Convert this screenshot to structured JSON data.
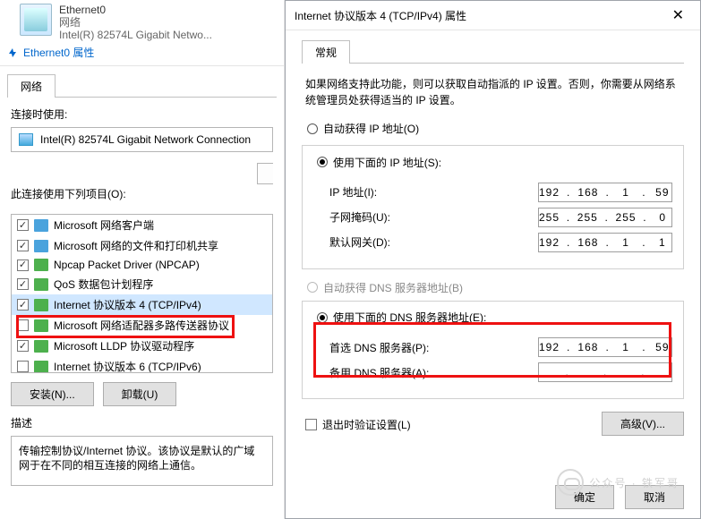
{
  "header": {
    "adapter_name": "Ethernet0",
    "adapter_sub": "网络",
    "adapter_model": "Intel(R) 82574L Gigabit Netwo..."
  },
  "breadcrumb": {
    "text": "Ethernet0 属性"
  },
  "left": {
    "tab_network": "网络",
    "connect_using": "连接时使用:",
    "adapter_full": "Intel(R) 82574L Gigabit Network Connection",
    "items_label": "此连接使用下列项目(O):",
    "items": [
      {
        "checked": true,
        "label": "Microsoft 网络客户端"
      },
      {
        "checked": true,
        "label": "Microsoft 网络的文件和打印机共享"
      },
      {
        "checked": true,
        "label": "Npcap Packet Driver (NPCAP)"
      },
      {
        "checked": true,
        "label": "QoS 数据包计划程序"
      },
      {
        "checked": true,
        "label": "Internet 协议版本 4 (TCP/IPv4)"
      },
      {
        "checked": false,
        "label": "Microsoft 网络适配器多路传送器协议"
      },
      {
        "checked": true,
        "label": "Microsoft LLDP 协议驱动程序"
      },
      {
        "checked": false,
        "label": "Internet 协议版本 6 (TCP/IPv6)"
      }
    ],
    "btn_install": "安装(N)...",
    "btn_uninstall": "卸载(U)",
    "desc_title": "描述",
    "desc_text": "传输控制协议/Internet 协议。该协议是默认的广域网于在不同的相互连接的网络上通信。"
  },
  "dlg": {
    "title": "Internet 协议版本 4 (TCP/IPv4) 属性",
    "tab_general": "常规",
    "info": "如果网络支持此功能，则可以获取自动指派的 IP 设置。否则，你需要从网络系统管理员处获得适当的 IP 设置。",
    "radio_auto_ip": "自动获得 IP 地址(O)",
    "radio_use_ip": "使用下面的 IP 地址(S):",
    "lbl_ip": "IP 地址(I):",
    "lbl_mask": "子网掩码(U):",
    "lbl_gw": "默认网关(D):",
    "ip": [
      "192",
      "168",
      "1",
      "59"
    ],
    "mask": [
      "255",
      "255",
      "255",
      "0"
    ],
    "gw": [
      "192",
      "168",
      "1",
      "1"
    ],
    "radio_auto_dns": "自动获得 DNS 服务器地址(B)",
    "radio_use_dns": "使用下面的 DNS 服务器地址(E):",
    "lbl_dns1": "首选 DNS 服务器(P):",
    "lbl_dns2": "备用 DNS 服务器(A):",
    "dns1": [
      "192",
      "168",
      "1",
      "59"
    ],
    "dns2": [
      "",
      "",
      "",
      ""
    ],
    "chk_validate": "退出时验证设置(L)",
    "btn_adv": "高级(V)...",
    "btn_ok": "确定",
    "btn_cancel": "取消"
  },
  "watermark": "公众号 · 铁军哥"
}
